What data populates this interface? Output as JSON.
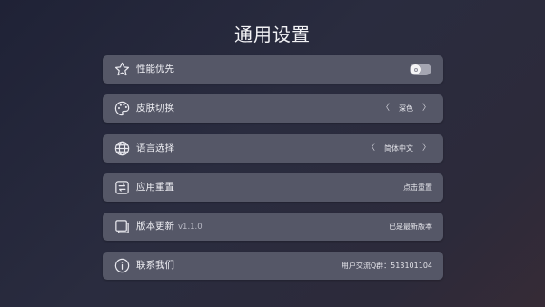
{
  "page": {
    "title": "通用设置"
  },
  "settings": {
    "performance": {
      "label": "性能优先",
      "icon": "star-outline-icon",
      "toggle_on": false
    },
    "skin": {
      "label": "皮肤切换",
      "icon": "palette-icon",
      "value": "深色",
      "prev": "〈",
      "next": "〉"
    },
    "language": {
      "label": "语言选择",
      "icon": "globe-icon",
      "value": "简体中文",
      "prev": "〈",
      "next": "〉"
    },
    "reset": {
      "label": "应用重置",
      "icon": "reset-icon",
      "action": "点击重置"
    },
    "update": {
      "label": "版本更新",
      "version": "v1.1.0",
      "icon": "document-icon",
      "status": "已是最新版本"
    },
    "contact": {
      "label": "联系我们",
      "icon": "info-icon",
      "detail": "用户交流Q群：513101104"
    }
  },
  "colors": {
    "row_bg": "#555767",
    "accent_text": "#ececf1",
    "toggle_off": "#a5a6b2"
  }
}
